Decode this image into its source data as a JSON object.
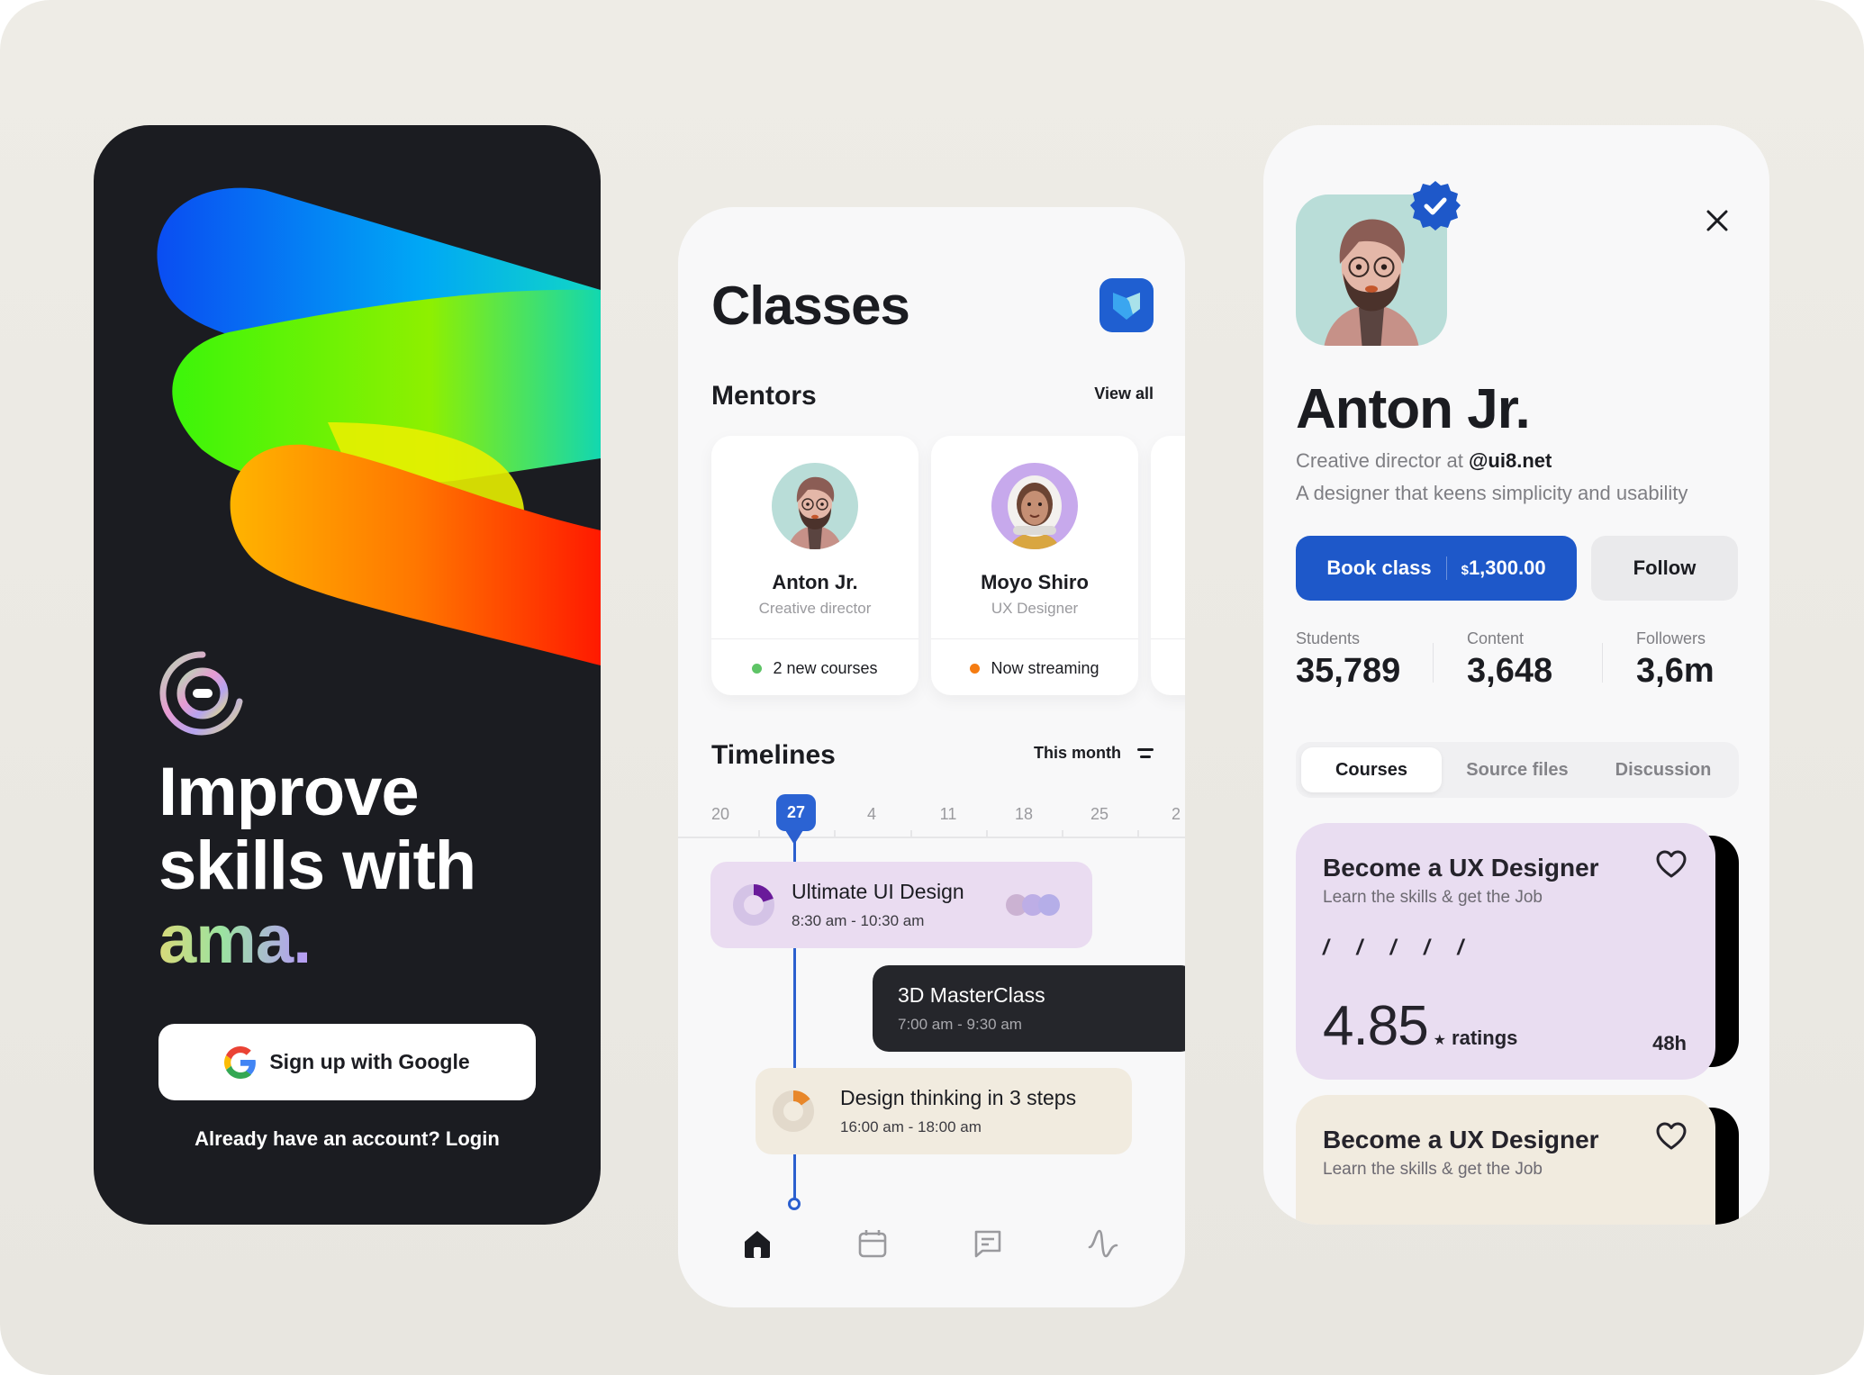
{
  "onboarding": {
    "headline_line1": "Improve",
    "headline_line2": "skills with",
    "brand": "ama.",
    "google_button": "Sign up with Google",
    "login_prompt": "Already have an account? Login",
    "logo_icon": "ama-logo-icon",
    "google_icon": "google-g-icon"
  },
  "classes": {
    "title": "Classes",
    "app_badge_icon": "shield-logo-icon",
    "mentors_title": "Mentors",
    "view_all": "View all",
    "mentors": [
      {
        "name": "Anton Jr.",
        "role": "Creative director",
        "status": "2 new courses",
        "status_color": "#5ec466"
      },
      {
        "name": "Moyo Shiro",
        "role": "UX Designer",
        "status": "Now streaming",
        "status_color": "#f57c12"
      }
    ],
    "timelines_title": "Timelines",
    "filter_label": "This month",
    "filter_icon": "filter-icon",
    "dates": [
      "20",
      "27",
      "4",
      "11",
      "18",
      "25",
      "2"
    ],
    "selected_date": "27",
    "events": [
      {
        "title": "Ultimate UI Design",
        "time": "8:30 am - 10:30 am",
        "progress": 0.2,
        "accent": "#6a1b9a"
      },
      {
        "title": "3D MasterClass",
        "time": "7:00 am - 9:30 am"
      },
      {
        "title": "Design thinking in 3 steps",
        "time": "16:00 am - 18:00 am",
        "progress": 0.15,
        "accent": "#e8872a"
      }
    ],
    "nav": [
      {
        "icon": "home-icon",
        "active": true
      },
      {
        "icon": "calendar-icon",
        "active": false
      },
      {
        "icon": "chat-icon",
        "active": false
      },
      {
        "icon": "activity-icon",
        "active": false
      }
    ]
  },
  "profile": {
    "name": "Anton Jr.",
    "role_prefix": "Creative director at ",
    "role_handle": "@ui8.net",
    "bio": "A designer that keens simplicity and usability",
    "verified": true,
    "book_label": "Book class",
    "price_currency": "$",
    "price": "1,300.00",
    "follow_label": "Follow",
    "stats": [
      {
        "label": "Students",
        "value": "35,789"
      },
      {
        "label": "Content",
        "value": "3,648"
      },
      {
        "label": "Followers",
        "value": "3,6m"
      }
    ],
    "tabs": [
      "Courses",
      "Source files",
      "Discussion"
    ],
    "active_tab": "Courses",
    "courses": [
      {
        "title": "Become a UX Designer",
        "subtitle": "Learn the skills & get the Job",
        "slashes": "/ / / / /",
        "rating": "4.85",
        "rating_label": "ratings",
        "hours": "48h",
        "bg": "#e9ddf1"
      },
      {
        "title": "Become a UX Designer",
        "subtitle": "Learn the skills & get the Job",
        "bg": "#f1ebdf"
      }
    ]
  },
  "colors": {
    "primary_blue": "#1e58c9",
    "dark": "#1b1c21",
    "background": "#eeece6"
  }
}
